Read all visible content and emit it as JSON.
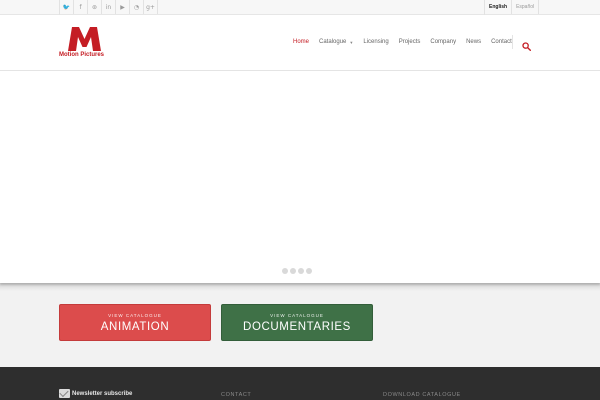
{
  "topbar": {
    "social": [
      {
        "name": "twitter-icon",
        "glyph": "🐦"
      },
      {
        "name": "facebook-icon",
        "glyph": "f"
      },
      {
        "name": "dribbble-icon",
        "glyph": "⊛"
      },
      {
        "name": "linkedin-icon",
        "glyph": "in"
      },
      {
        "name": "youtube-icon",
        "glyph": "▶"
      },
      {
        "name": "rss-icon",
        "glyph": "◔"
      },
      {
        "name": "googleplus-icon",
        "glyph": "g+"
      }
    ],
    "languages": [
      {
        "label": "English",
        "active": true
      },
      {
        "label": "Español",
        "active": false
      }
    ]
  },
  "header": {
    "logo_text": "Motion Pictures",
    "brand_color": "#c41d24",
    "nav": [
      {
        "label": "Home",
        "active": true,
        "has_dropdown": false
      },
      {
        "label": "Catalogue",
        "active": false,
        "has_dropdown": true
      },
      {
        "label": "Licensing",
        "active": false,
        "has_dropdown": false
      },
      {
        "label": "Projects",
        "active": false,
        "has_dropdown": false
      },
      {
        "label": "Company",
        "active": false,
        "has_dropdown": false
      },
      {
        "label": "News",
        "active": false,
        "has_dropdown": false
      },
      {
        "label": "Contact",
        "active": false,
        "has_dropdown": false
      }
    ],
    "search_icon": "search-icon"
  },
  "slider": {
    "dot_count": 4
  },
  "cta": {
    "animation": {
      "small": "VIEW CATALOGUE",
      "big": "ANIMATION",
      "color": "#dc4c4c"
    },
    "documentaries": {
      "small": "VIEW CATALOGUE",
      "big": "DOCUMENTARIES",
      "color": "#3f7147"
    }
  },
  "footer": {
    "newsletter": "Newsletter subscribe",
    "contact": "CONTACT",
    "download": "DOWNLOAD CATALOGUE"
  }
}
